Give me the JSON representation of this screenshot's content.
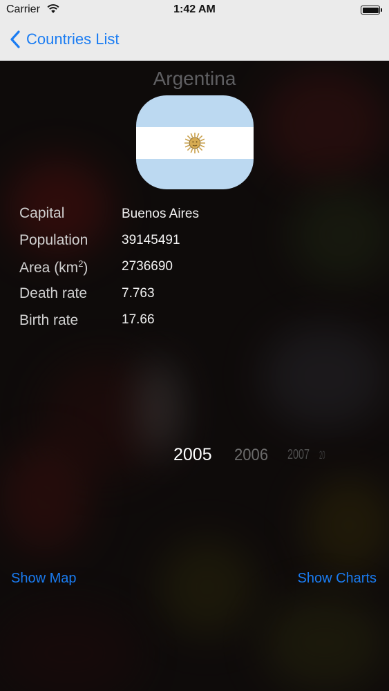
{
  "status_bar": {
    "carrier": "Carrier",
    "time": "1:42 AM"
  },
  "nav": {
    "back_label": "Countries List"
  },
  "country": {
    "name": "Argentina",
    "flag_icon": "argentina-flag-icon"
  },
  "details": [
    {
      "label": "Capital",
      "value": "Buenos Aires"
    },
    {
      "label": "Population",
      "value": "39145491"
    },
    {
      "label": "Area (km",
      "label_sup": "2",
      "label_suffix": ")",
      "value": "2736690"
    },
    {
      "label": "Death rate",
      "value": "7.763"
    },
    {
      "label": "Birth rate",
      "value": "17.66"
    }
  ],
  "years": {
    "selected": "2005",
    "options": [
      "2005",
      "2006",
      "2007",
      "20"
    ]
  },
  "actions": {
    "show_map": "Show Map",
    "show_charts": "Show Charts"
  },
  "colors": {
    "accent": "#1a7cf2",
    "flag_blue": "#bcd9f1",
    "flag_white": "#ffffff",
    "sun": "#c9a04a"
  }
}
